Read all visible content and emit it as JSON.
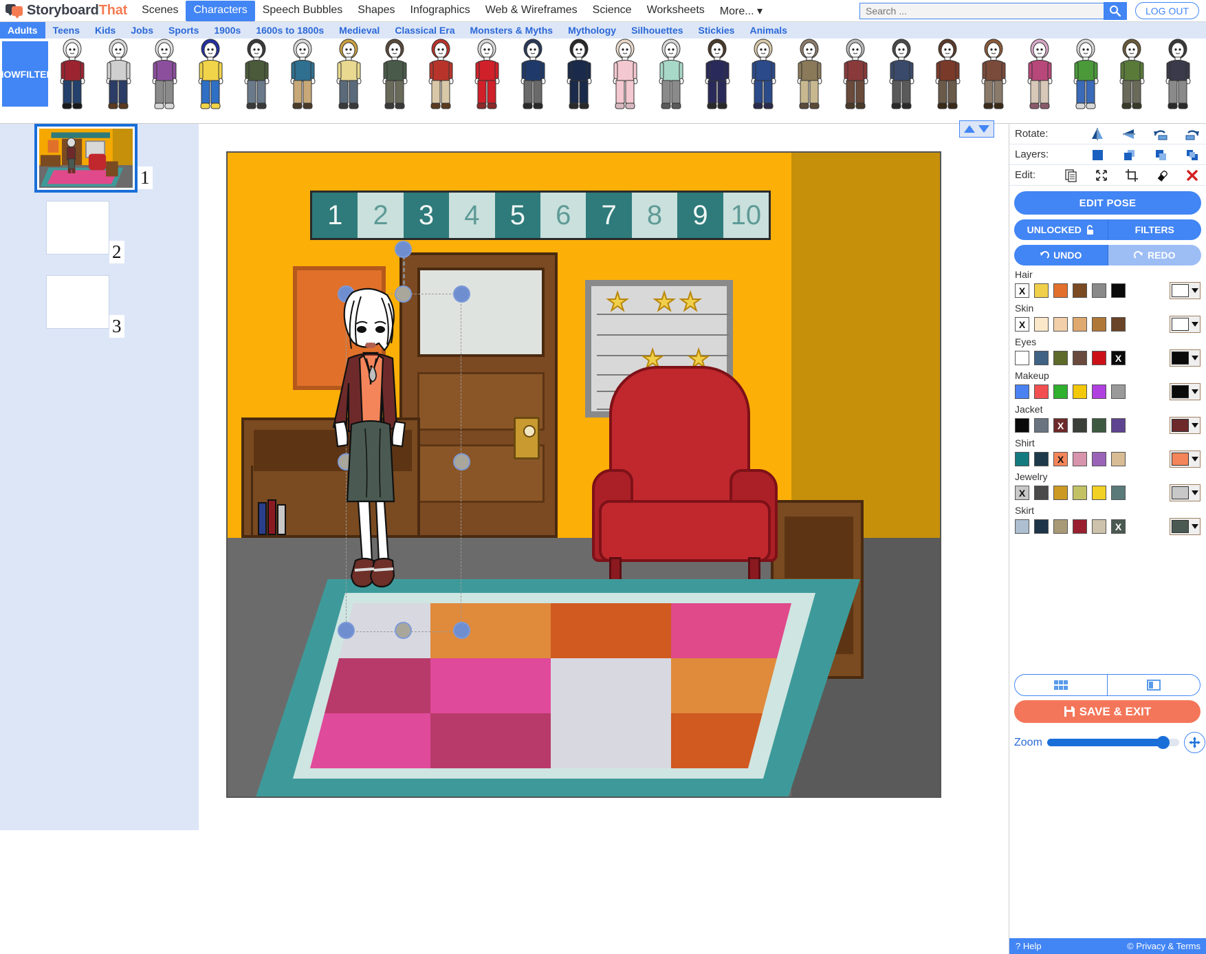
{
  "header": {
    "brand_dark": "Storyboard",
    "brand_orange": "That",
    "nav": [
      {
        "label": "Scenes",
        "active": false
      },
      {
        "label": "Characters",
        "active": true
      },
      {
        "label": "Speech Bubbles",
        "active": false
      },
      {
        "label": "Shapes",
        "active": false
      },
      {
        "label": "Infographics",
        "active": false
      },
      {
        "label": "Web & Wireframes",
        "active": false
      },
      {
        "label": "Science",
        "active": false
      },
      {
        "label": "Worksheets",
        "active": false
      },
      {
        "label": "More... ▾",
        "active": false
      }
    ],
    "search_placeholder": "Search ...",
    "search_value": "",
    "search_icon": "magnifier-icon",
    "logout_label": "LOG OUT"
  },
  "subnav": {
    "items": [
      {
        "label": "Adults",
        "active": true
      },
      {
        "label": "Teens",
        "active": false
      },
      {
        "label": "Kids",
        "active": false
      },
      {
        "label": "Jobs",
        "active": false
      },
      {
        "label": "Sports",
        "active": false
      },
      {
        "label": "1900s",
        "active": false
      },
      {
        "label": "1600s to 1800s",
        "active": false
      },
      {
        "label": "Medieval",
        "active": false
      },
      {
        "label": "Classical Era",
        "active": false
      },
      {
        "label": "Monsters & Myths",
        "active": false
      },
      {
        "label": "Mythology",
        "active": false
      },
      {
        "label": "Silhouettes",
        "active": false
      },
      {
        "label": "Stickies",
        "active": false
      },
      {
        "label": "Animals",
        "active": false
      }
    ]
  },
  "character_strip": {
    "show_filters_label": "SHOW\nFILTERS",
    "show_filters_line1": "SHOW",
    "show_filters_line2": "FILTERS",
    "thumbs": [
      {
        "hair": "#e8e8e8",
        "top": "#9b2430",
        "bottom": "#24406b",
        "shoes": "#1a1a1a",
        "skin": "#ffffff"
      },
      {
        "hair": "#d8d8d8",
        "top": "#cfcfcf",
        "bottom": "#2b3d66",
        "shoes": "#5a3a20",
        "skin": "#ffffff"
      },
      {
        "hair": "#e0e0e0",
        "top": "#8c4f9e",
        "bottom": "#8a8a8a",
        "shoes": "#d8d8d8",
        "skin": "#ffffff"
      },
      {
        "hair": "#2430a0",
        "top": "#f2d44a",
        "bottom": "#2f6fc4",
        "shoes": "#f2d44a",
        "skin": "#ffffff"
      },
      {
        "hair": "#3a3a3a",
        "top": "#4a5a3a",
        "bottom": "#6a7a8a",
        "shoes": "#3a3a3a",
        "skin": "#ffffff"
      },
      {
        "hair": "#d8d8d8",
        "top": "#2f6f8f",
        "bottom": "#c8a878",
        "shoes": "#4a3a2a",
        "skin": "#ffffff"
      },
      {
        "hair": "#c8a040",
        "top": "#e8d890",
        "bottom": "#5a6a7a",
        "shoes": "#3a3a3a",
        "skin": "#ffffff"
      },
      {
        "hair": "#5a4a3a",
        "top": "#4a5a4a",
        "bottom": "#6a6a5a",
        "shoes": "#3a3a3a",
        "skin": "#ffffff"
      },
      {
        "hair": "#b8342a",
        "top": "#b8342a",
        "bottom": "#d8c8a8",
        "shoes": "#5a3a20",
        "skin": "#ffffff"
      },
      {
        "hair": "#d8d8d8",
        "top": "#d0202a",
        "bottom": "#d0202a",
        "shoes": "#8a2a2a",
        "skin": "#ffffff"
      },
      {
        "hair": "#2a3a5a",
        "top": "#1f3a6a",
        "bottom": "#6a6a6a",
        "shoes": "#2a2a2a",
        "skin": "#ffffff"
      },
      {
        "hair": "#2a2a2a",
        "top": "#1a2a4a",
        "bottom": "#1a2a4a",
        "shoes": "#2a2a2a",
        "skin": "#ffffff"
      },
      {
        "hair": "#e8d8c8",
        "top": "#f4c8d0",
        "bottom": "#f4c8d0",
        "shoes": "#d8b8c0",
        "skin": "#ffffff"
      },
      {
        "hair": "#d8d8d8",
        "top": "#a8d8c8",
        "bottom": "#8a8a8a",
        "shoes": "#5a5a5a",
        "skin": "#ffffff"
      },
      {
        "hair": "#4a3a2a",
        "top": "#2a2a5a",
        "bottom": "#2a2a5a",
        "shoes": "#2a2a2a",
        "skin": "#ffffff"
      },
      {
        "hair": "#d8c8a8",
        "top": "#2a4a8a",
        "bottom": "#2a4a8a",
        "shoes": "#2a2a4a",
        "skin": "#ffffff"
      },
      {
        "hair": "#8a7a6a",
        "top": "#8a7a5a",
        "bottom": "#c8b890",
        "shoes": "#5a4a3a",
        "skin": "#ffffff"
      },
      {
        "hair": "#b8b8b8",
        "top": "#8a3a3a",
        "bottom": "#6a4a3a",
        "shoes": "#4a3a2a",
        "skin": "#ffffff"
      },
      {
        "hair": "#4a4a4a",
        "top": "#3a4a6a",
        "bottom": "#5a5a5a",
        "shoes": "#2a2a2a",
        "skin": "#ffffff"
      },
      {
        "hair": "#5a3a2a",
        "top": "#7a3a2a",
        "bottom": "#6a5a4a",
        "shoes": "#3a2a1a",
        "skin": "#ffffff"
      },
      {
        "hair": "#8a5a3a",
        "top": "#7a4a3a",
        "bottom": "#8a7a6a",
        "shoes": "#3a2a1a",
        "skin": "#ffffff"
      },
      {
        "hair": "#d8a8c8",
        "top": "#b8487a",
        "bottom": "#d8c8b8",
        "shoes": "#8a5a6a",
        "skin": "#ffffff"
      },
      {
        "hair": "#d8d8d8",
        "top": "#4a9a3a",
        "bottom": "#3a6ab8",
        "shoes": "#d8d8d8",
        "skin": "#ffffff"
      },
      {
        "hair": "#6a5a3a",
        "top": "#5a7a3a",
        "bottom": "#6a6a5a",
        "shoes": "#3a3a2a",
        "skin": "#ffffff"
      },
      {
        "hair": "#3a3a3a",
        "top": "#3a3a4a",
        "bottom": "#8a8a8a",
        "shoes": "#2a2a2a",
        "skin": "#ffffff"
      },
      {
        "hair": "#d8d8d8",
        "top": "#3a7a6a",
        "bottom": "#d86a2a",
        "shoes": "#5a4a3a",
        "skin": "#ffffff"
      }
    ]
  },
  "cells": [
    {
      "number": "1",
      "selected": true,
      "empty": false
    },
    {
      "number": "2",
      "selected": false,
      "empty": true
    },
    {
      "number": "3",
      "selected": false,
      "empty": true
    }
  ],
  "canvas": {
    "scroll_up_icon": "triangle-up-icon",
    "scroll_down_icon": "triangle-down-icon",
    "number_line": [
      "1",
      "2",
      "3",
      "4",
      "5",
      "6",
      "7",
      "8",
      "9",
      "10"
    ],
    "scene_name": "classroom-interior",
    "selected_object": "adult-female-character"
  },
  "right_panel": {
    "rotate": {
      "label": "Rotate:",
      "icons": [
        "flip-horizontal-icon",
        "flip-vertical-icon",
        "rotate-left-icon",
        "rotate-right-icon"
      ]
    },
    "layers": {
      "label": "Layers:",
      "icons": [
        "bring-to-front-icon",
        "bring-forward-icon",
        "send-backward-icon",
        "send-to-back-icon"
      ]
    },
    "edit": {
      "label": "Edit:",
      "icons": [
        "copy-icon",
        "resize-icon",
        "crop-icon",
        "eraser-icon",
        "delete-icon"
      ]
    },
    "edit_pose_label": "EDIT POSE",
    "unlocked_label": "UNLOCKED",
    "unlocked_icon": "unlock-icon",
    "filters_label": "FILTERS",
    "undo_label": "UNDO",
    "undo_icon": "undo-arrow-icon",
    "redo_label": "REDO",
    "redo_icon": "redo-arrow-icon",
    "swatch_groups": [
      {
        "label": "Hair",
        "swatches": [
          {
            "color": "#ffffff",
            "x": true
          },
          {
            "color": "#f0cf4a",
            "x": false
          },
          {
            "color": "#e2702c",
            "x": false
          },
          {
            "color": "#7a4a22",
            "x": false
          },
          {
            "color": "#8a8a8a",
            "x": false
          },
          {
            "color": "#0a0a0a",
            "x": false
          }
        ],
        "current": "#ffffff"
      },
      {
        "label": "Skin",
        "swatches": [
          {
            "color": "#ffffff",
            "x": true
          },
          {
            "color": "#fbe8ca",
            "x": false
          },
          {
            "color": "#f2cfa8",
            "x": false
          },
          {
            "color": "#dfa86e",
            "x": false
          },
          {
            "color": "#b07838",
            "x": false
          },
          {
            "color": "#6a4428",
            "x": false
          }
        ],
        "current": "#ffffff"
      },
      {
        "label": "Eyes",
        "swatches": [
          {
            "color": "#ffffff",
            "x": false
          },
          {
            "color": "#3f6285",
            "x": false
          },
          {
            "color": "#5d6a2a",
            "x": false
          },
          {
            "color": "#6a4a3c",
            "x": false
          },
          {
            "color": "#cc1018",
            "x": false
          },
          {
            "color": "#0a0a0a",
            "x": true
          }
        ],
        "current": "#0a0a0a"
      },
      {
        "label": "Makeup",
        "swatches": [
          {
            "color": "#4a82f2",
            "x": false
          },
          {
            "color": "#f25050",
            "x": false
          },
          {
            "color": "#2fb02f",
            "x": false
          },
          {
            "color": "#f2c808",
            "x": false
          },
          {
            "color": "#b040e0",
            "x": false
          },
          {
            "color": "#9a9a9a",
            "x": false
          }
        ],
        "current": "#0a0a0a"
      },
      {
        "label": "Jacket",
        "swatches": [
          {
            "color": "#0a0a0a",
            "x": false
          },
          {
            "color": "#6a7480",
            "x": false
          },
          {
            "color": "#6e2a2a",
            "x": true
          },
          {
            "color": "#3a3f38",
            "x": false
          },
          {
            "color": "#3d5a40",
            "x": false
          },
          {
            "color": "#5e4490",
            "x": false
          }
        ],
        "current": "#6e2a2a"
      },
      {
        "label": "Shirt",
        "swatches": [
          {
            "color": "#147a80",
            "x": false
          },
          {
            "color": "#1e3a4a",
            "x": false
          },
          {
            "color": "#f4855a",
            "x": true
          },
          {
            "color": "#d893ac",
            "x": false
          },
          {
            "color": "#9a63b8",
            "x": false
          },
          {
            "color": "#d8bc94",
            "x": false
          }
        ],
        "current": "#f4855a"
      },
      {
        "label": "Jewelry",
        "swatches": [
          {
            "color": "#c8c8c8",
            "x": true
          },
          {
            "color": "#4a4a4a",
            "x": false
          },
          {
            "color": "#cc9a22",
            "x": false
          },
          {
            "color": "#c2c265",
            "x": false
          },
          {
            "color": "#f2d024",
            "x": false
          },
          {
            "color": "#5a7a7a",
            "x": false
          }
        ],
        "current": "#c8c8c8"
      },
      {
        "label": "Skirt",
        "swatches": [
          {
            "color": "#adbfd0",
            "x": false
          },
          {
            "color": "#1e3448",
            "x": false
          },
          {
            "color": "#a89a76",
            "x": false
          },
          {
            "color": "#9a2030",
            "x": false
          },
          {
            "color": "#cdc3ac",
            "x": false
          },
          {
            "color": "#4a5a52",
            "x": true
          }
        ],
        "current": "#4a5a52"
      }
    ],
    "view_grid_icon": "grid-view-icon",
    "view_split_icon": "split-view-icon",
    "save_exit_label": "SAVE & EXIT",
    "save_icon": "floppy-disk-icon",
    "zoom_label": "Zoom",
    "zoom_percent": 88,
    "fit_icon": "fit-to-screen-icon",
    "help_label": "Help",
    "help_icon": "question-mark-icon",
    "privacy_label": "Privacy & Terms",
    "privacy_icon": "copyright-icon"
  }
}
